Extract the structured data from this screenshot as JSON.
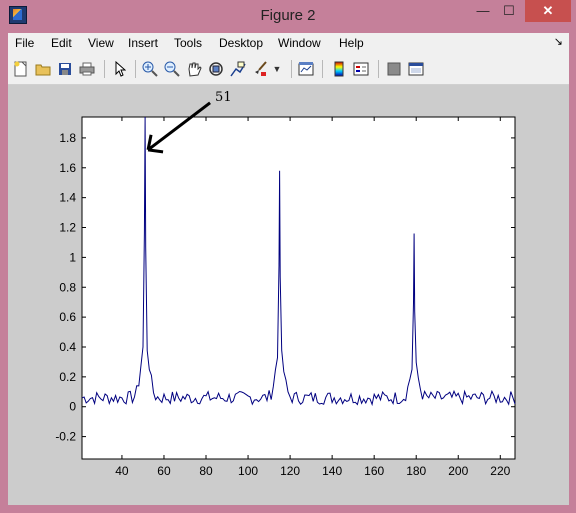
{
  "window": {
    "title": "Figure 2",
    "close_glyph": "✕",
    "min_glyph": "—",
    "max_glyph": "☐"
  },
  "menu": [
    {
      "label": "File"
    },
    {
      "label": "Edit"
    },
    {
      "label": "View"
    },
    {
      "label": "Insert"
    },
    {
      "label": "Tools"
    },
    {
      "label": "Desktop"
    },
    {
      "label": "Window"
    },
    {
      "label": "Help"
    }
  ],
  "toolbar": {
    "icons": [
      "new-figure-icon",
      "open-file-icon",
      "save-icon",
      "print-icon",
      "pointer-icon",
      "zoom-in-icon",
      "zoom-out-icon",
      "pan-hand-icon",
      "rotate-3d-icon",
      "data-cursor-icon",
      "brush-icon",
      "link-plot-icon",
      "colorbar-icon",
      "legend-icon",
      "hide-plot-tools-icon",
      "show-plot-tools-icon"
    ]
  },
  "colors": {
    "line": "#000080",
    "axes_bg": "#ffffff",
    "figure_bg": "#cccccc"
  },
  "chart_data": {
    "type": "line",
    "title": "",
    "xlabel": "",
    "ylabel": "",
    "xlim": [
      21,
      227
    ],
    "ylim": [
      -0.35,
      1.94
    ],
    "xticks": [
      40,
      60,
      80,
      100,
      120,
      140,
      160,
      180,
      200,
      220
    ],
    "yticks": [
      -0.2,
      0,
      0.2,
      0.4,
      0.6,
      0.8,
      1,
      1.2,
      1.4,
      1.6,
      1.8
    ],
    "grid": false,
    "annotation": {
      "text": "51",
      "x": 51,
      "y": 1.72
    },
    "peaks": [
      {
        "x": 51,
        "y": 1.94
      },
      {
        "x": 115,
        "y": 1.58
      },
      {
        "x": 179,
        "y": 1.16
      }
    ],
    "baseline_mean": 0.06
  }
}
